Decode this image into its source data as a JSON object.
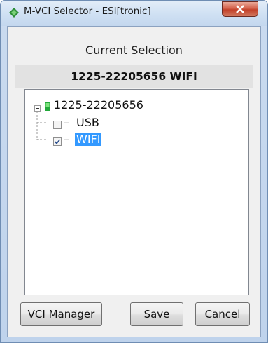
{
  "window": {
    "title": "M-VCI Selector - ESI[tronic]",
    "close_icon": "close-icon",
    "app_icon": "diamond-app-icon"
  },
  "selection": {
    "label": "Current Selection",
    "value": "1225-22205656 WIFI"
  },
  "tree": {
    "root": {
      "label": "1225-22205656",
      "expanded": true,
      "icon": "green-device-icon"
    },
    "children": [
      {
        "label": "USB",
        "checked": false,
        "selected": false
      },
      {
        "label": "WIFI",
        "checked": true,
        "selected": true
      }
    ]
  },
  "buttons": {
    "vci_manager": "VCI Manager",
    "save": "Save",
    "cancel": "Cancel"
  },
  "colors": {
    "selection_highlight": "#3399ff",
    "device_icon": "#22a83a",
    "close_button": "#c9452d"
  }
}
